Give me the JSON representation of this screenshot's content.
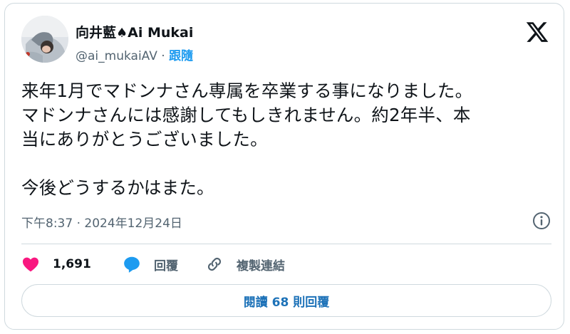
{
  "author": {
    "name_prefix": "向井藍",
    "name_symbol": "♠",
    "name_suffix": "Ai Mukai",
    "handle": "@ai_mukaiAV",
    "separator": "·",
    "follow_label": "跟隨"
  },
  "tweet": {
    "text": "来年1月でマドンナさん専属を卒業する事になりました。\nマドンナさんには感謝してもしきれません。約2年半、本\n当にありがとうございました。\n\n今後どうするかはまた。",
    "timestamp": "下午8:37 · 2024年12月24日"
  },
  "actions": {
    "like_count": "1,691",
    "reply_label": "回覆",
    "copy_link_label": "複製連結"
  },
  "replies_button": {
    "label": "閱讀 68 則回覆"
  },
  "colors": {
    "like": "#f91880",
    "reply_bubble": "#1d9bf0",
    "link": "#1d9bf0",
    "border": "#cfd9de",
    "secondary_text": "#536471"
  },
  "icons": [
    "avatar-photo",
    "x-logo-icon",
    "info-icon",
    "heart-icon",
    "reply-bubble-icon",
    "link-icon"
  ]
}
